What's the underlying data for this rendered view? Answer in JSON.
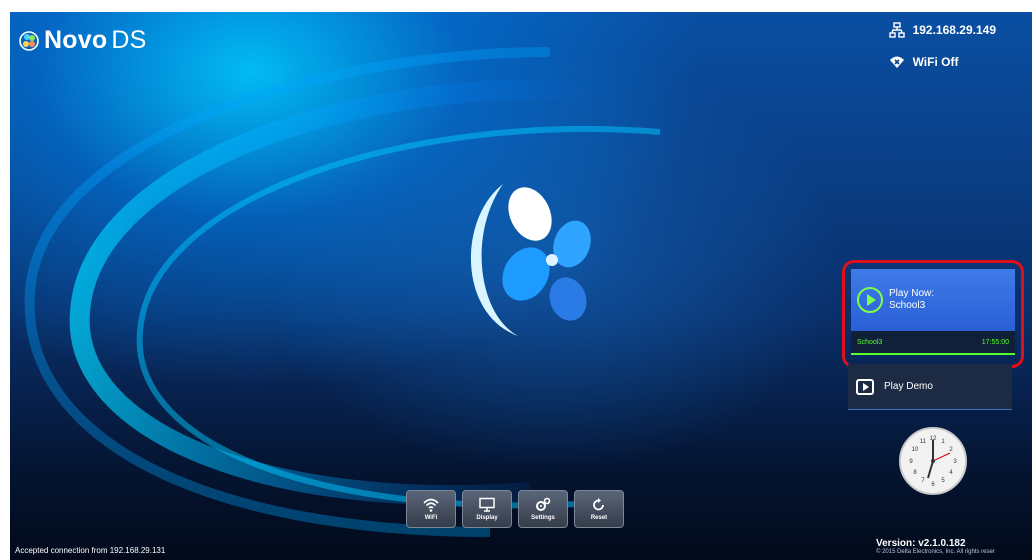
{
  "app": {
    "logo_prefix": "Novo",
    "logo_suffix": "DS"
  },
  "network": {
    "ip": "192.168.29.149",
    "wifi": "WiFi Off"
  },
  "play_now": {
    "label": "Play Now:",
    "title": "School3",
    "schedule_name": "School3",
    "schedule_time": "17:55:00"
  },
  "demo": {
    "label": "Play Demo"
  },
  "toolbar": {
    "wifi": "WiFi",
    "display": "Display",
    "settings": "Settings",
    "reset": "Reset"
  },
  "status": {
    "message": "Accepted connection from 192.168.29.131"
  },
  "version": {
    "text": "Version: v2.1.0.182",
    "copyright": "© 2015 Delta Electronics, Inc. All rights reser"
  },
  "clock": {
    "numbers": [
      "12",
      "1",
      "2",
      "3",
      "4",
      "5",
      "6",
      "7",
      "8",
      "9",
      "10",
      "11"
    ]
  },
  "colors": {
    "accent": "#3f7be8",
    "highlight": "#e0101a",
    "status_ok": "#39d93a",
    "schedule": "#58ff2f"
  }
}
